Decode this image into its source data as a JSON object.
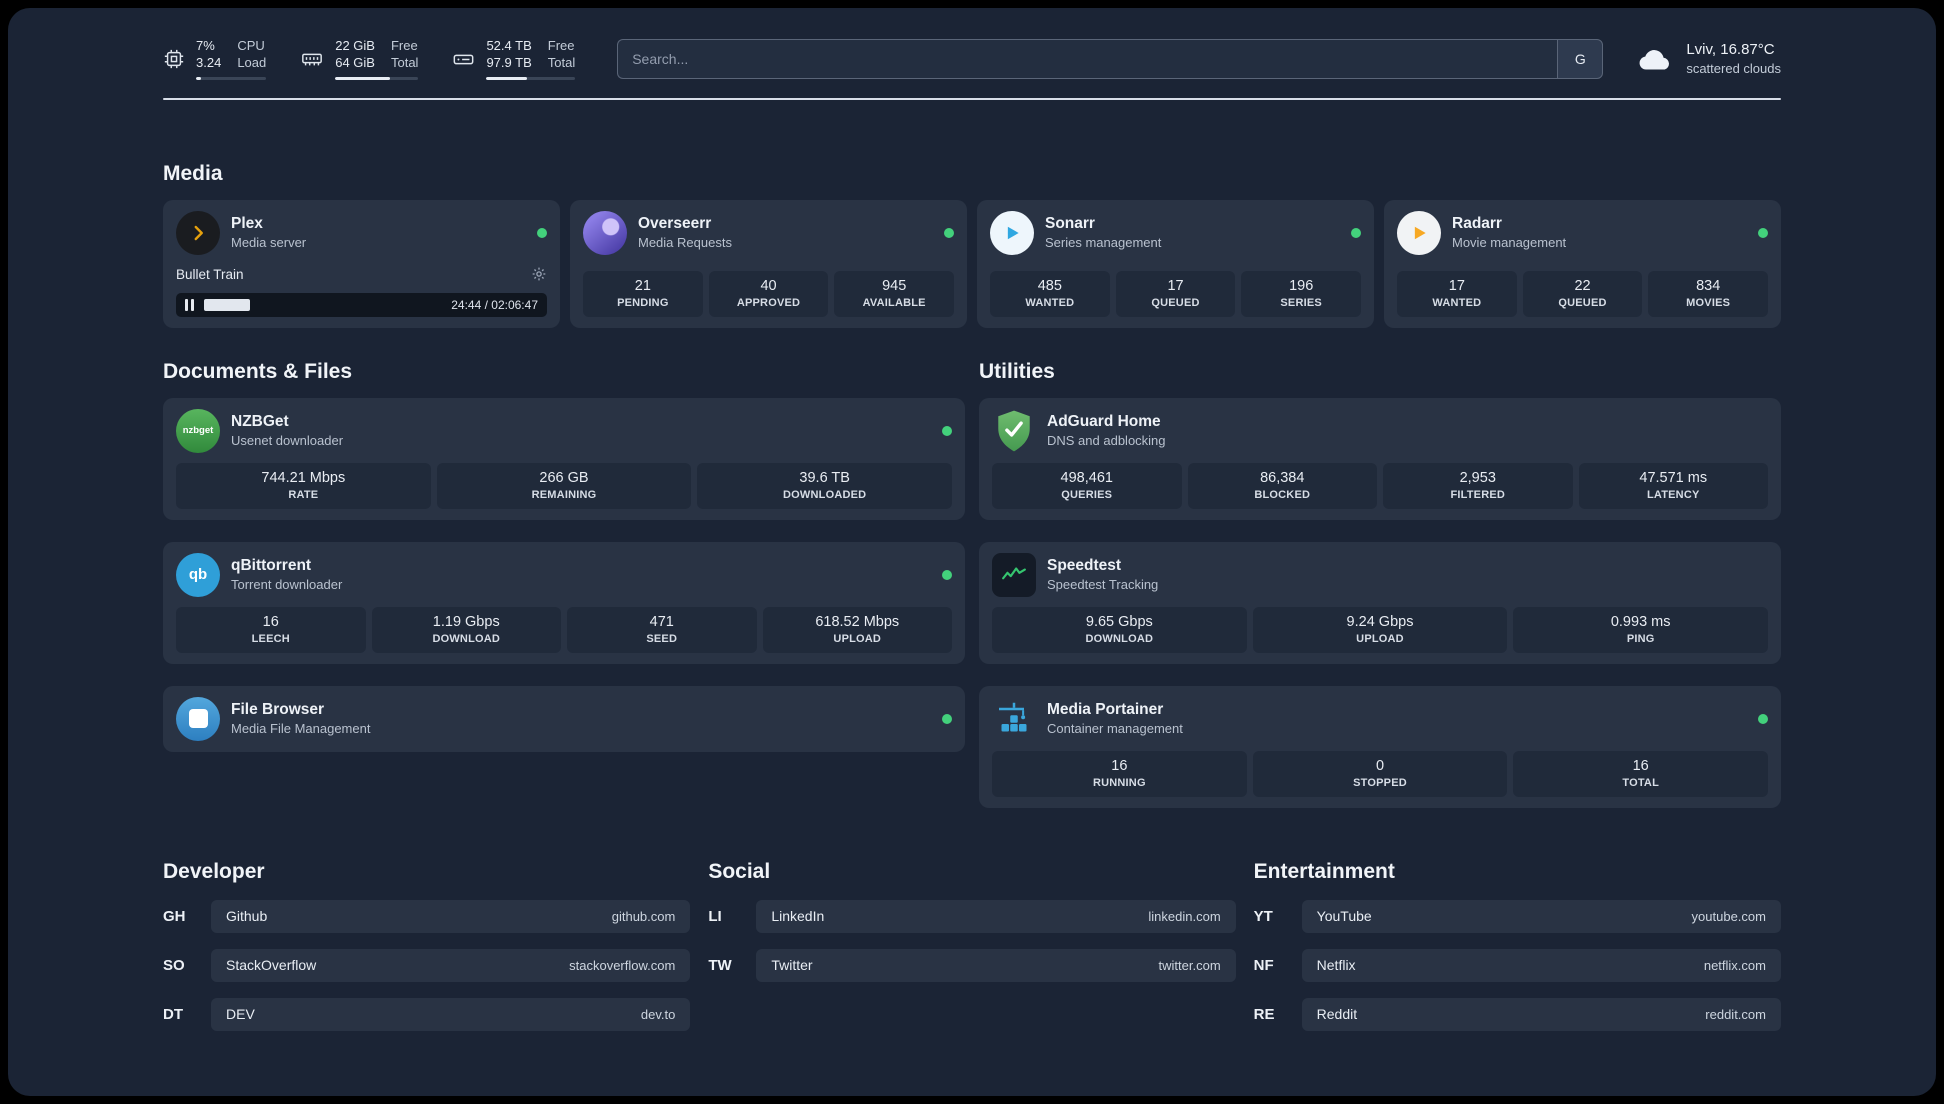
{
  "colors": {
    "status_ok": "#43d17c",
    "plex_accent": "#e5a00d",
    "panel_bg": "#1b2435",
    "card_bg": "#293344",
    "tile_bg": "#202a3a"
  },
  "topbar": {
    "cpu": {
      "value_top": "7%",
      "value_bottom": "3.24",
      "label_top": "CPU",
      "label_bottom": "Load",
      "fill_pct": 7
    },
    "ram": {
      "value_top": "22 GiB",
      "value_bottom": "64 GiB",
      "label_top": "Free",
      "label_bottom": "Total",
      "fill_pct": 66
    },
    "disk": {
      "value_top": "52.4 TB",
      "value_bottom": "97.9 TB",
      "label_top": "Free",
      "label_bottom": "Total",
      "fill_pct": 46
    },
    "search": {
      "placeholder": "Search...",
      "engine_button": "G"
    },
    "weather": {
      "location": "Lviv, 16.87°C",
      "condition": "scattered clouds"
    }
  },
  "media": {
    "title": "Media",
    "plex": {
      "name": "Plex",
      "desc": "Media server",
      "now_playing": "Bullet Train",
      "time": "24:44 / 02:06:47",
      "progress_pct": 19.5
    },
    "overseerr": {
      "name": "Overseerr",
      "desc": "Media Requests",
      "stats": [
        {
          "value": "21",
          "label": "PENDING"
        },
        {
          "value": "40",
          "label": "APPROVED"
        },
        {
          "value": "945",
          "label": "AVAILABLE"
        }
      ]
    },
    "sonarr": {
      "name": "Sonarr",
      "desc": "Series management",
      "stats": [
        {
          "value": "485",
          "label": "WANTED"
        },
        {
          "value": "17",
          "label": "QUEUED"
        },
        {
          "value": "196",
          "label": "SERIES"
        }
      ]
    },
    "radarr": {
      "name": "Radarr",
      "desc": "Movie management",
      "stats": [
        {
          "value": "17",
          "label": "WANTED"
        },
        {
          "value": "22",
          "label": "QUEUED"
        },
        {
          "value": "834",
          "label": "MOVIES"
        }
      ]
    }
  },
  "documents": {
    "title": "Documents & Files",
    "nzbget": {
      "name": "NZBGet",
      "desc": "Usenet downloader",
      "icon_text": "nzbget",
      "stats": [
        {
          "value": "744.21 Mbps",
          "label": "RATE"
        },
        {
          "value": "266 GB",
          "label": "REMAINING"
        },
        {
          "value": "39.6 TB",
          "label": "DOWNLOADED"
        }
      ]
    },
    "qbittorrent": {
      "name": "qBittorrent",
      "desc": "Torrent downloader",
      "icon_text": "qb",
      "stats": [
        {
          "value": "16",
          "label": "LEECH"
        },
        {
          "value": "1.19 Gbps",
          "label": "DOWNLOAD"
        },
        {
          "value": "471",
          "label": "SEED"
        },
        {
          "value": "618.52 Mbps",
          "label": "UPLOAD"
        }
      ]
    },
    "filebrowser": {
      "name": "File Browser",
      "desc": "Media File Management"
    }
  },
  "utilities": {
    "title": "Utilities",
    "adguard": {
      "name": "AdGuard Home",
      "desc": "DNS and adblocking",
      "stats": [
        {
          "value": "498,461",
          "label": "QUERIES"
        },
        {
          "value": "86,384",
          "label": "BLOCKED"
        },
        {
          "value": "2,953",
          "label": "FILTERED"
        },
        {
          "value": "47.571 ms",
          "label": "LATENCY"
        }
      ]
    },
    "speedtest": {
      "name": "Speedtest",
      "desc": "Speedtest Tracking",
      "stats": [
        {
          "value": "9.65 Gbps",
          "label": "DOWNLOAD"
        },
        {
          "value": "9.24 Gbps",
          "label": "UPLOAD"
        },
        {
          "value": "0.993 ms",
          "label": "PING"
        }
      ]
    },
    "portainer": {
      "name": "Media Portainer",
      "desc": "Container management",
      "stats": [
        {
          "value": "16",
          "label": "RUNNING"
        },
        {
          "value": "0",
          "label": "STOPPED"
        },
        {
          "value": "16",
          "label": "TOTAL"
        }
      ]
    }
  },
  "bookmarks": {
    "developer": {
      "title": "Developer",
      "items": [
        {
          "abbr": "GH",
          "name": "Github",
          "url": "github.com"
        },
        {
          "abbr": "SO",
          "name": "StackOverflow",
          "url": "stackoverflow.com"
        },
        {
          "abbr": "DT",
          "name": "DEV",
          "url": "dev.to"
        }
      ]
    },
    "social": {
      "title": "Social",
      "items": [
        {
          "abbr": "LI",
          "name": "LinkedIn",
          "url": "linkedin.com"
        },
        {
          "abbr": "TW",
          "name": "Twitter",
          "url": "twitter.com"
        }
      ]
    },
    "entertainment": {
      "title": "Entertainment",
      "items": [
        {
          "abbr": "YT",
          "name": "YouTube",
          "url": "youtube.com"
        },
        {
          "abbr": "NF",
          "name": "Netflix",
          "url": "netflix.com"
        },
        {
          "abbr": "RE",
          "name": "Reddit",
          "url": "reddit.com"
        }
      ]
    }
  }
}
